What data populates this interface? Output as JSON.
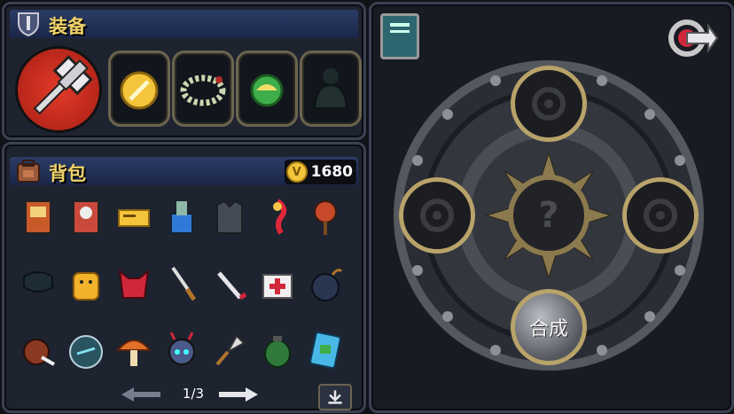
{
  "equipment": {
    "title": "装备",
    "slots": [
      {
        "icon": "hammer-icon"
      },
      {
        "icon": "gold-sword-coin-icon"
      },
      {
        "icon": "bead-necklace-icon"
      },
      {
        "icon": "green-orb-icon"
      },
      {
        "icon": "dark-armor-icon"
      }
    ]
  },
  "backpack": {
    "title": "背包",
    "currency": {
      "symbol": "V",
      "amount": "1680"
    },
    "page": "1/3",
    "sort_icon": "download-arrow-icon"
  },
  "crafting": {
    "center_symbol": "?",
    "craft_label": "合成"
  },
  "colors": {
    "accent": "#f0d36a",
    "header": "#2b3c66",
    "frame": "#6b6450"
  }
}
